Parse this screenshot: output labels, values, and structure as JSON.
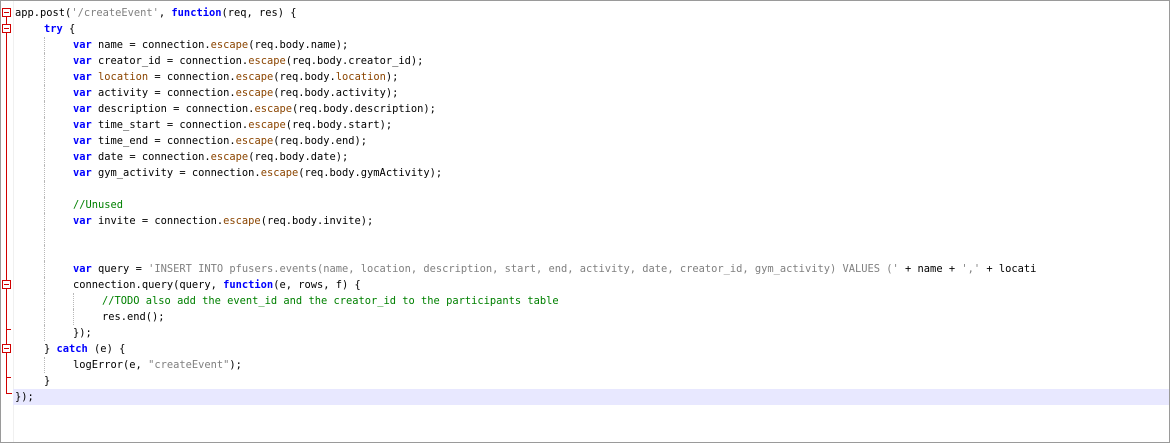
{
  "editor": {
    "lines": [
      {
        "indent": 0,
        "segments": [
          {
            "t": "app.post(",
            "c": "p"
          },
          {
            "t": "'/createEvent'",
            "c": "str"
          },
          {
            "t": ", ",
            "c": "p"
          },
          {
            "t": "function",
            "c": "kw"
          },
          {
            "t": "(req, res) {",
            "c": "p"
          }
        ]
      },
      {
        "indent": 1,
        "segments": [
          {
            "t": "try",
            "c": "kw"
          },
          {
            "t": " {",
            "c": "p"
          }
        ]
      },
      {
        "indent": 2,
        "segments": [
          {
            "t": "var",
            "c": "kw"
          },
          {
            "t": " name = connection.",
            "c": "p"
          },
          {
            "t": "escape",
            "c": "fn"
          },
          {
            "t": "(req.body.name);",
            "c": "p"
          }
        ]
      },
      {
        "indent": 2,
        "segments": [
          {
            "t": "var",
            "c": "kw"
          },
          {
            "t": " creator_id = connection.",
            "c": "p"
          },
          {
            "t": "escape",
            "c": "fn"
          },
          {
            "t": "(req.body.creator_id);",
            "c": "p"
          }
        ]
      },
      {
        "indent": 2,
        "segments": [
          {
            "t": "var",
            "c": "kw"
          },
          {
            "t": " ",
            "c": "p"
          },
          {
            "t": "location",
            "c": "fn"
          },
          {
            "t": " = connection.",
            "c": "p"
          },
          {
            "t": "escape",
            "c": "fn"
          },
          {
            "t": "(req.body.",
            "c": "p"
          },
          {
            "t": "location",
            "c": "fn"
          },
          {
            "t": ");",
            "c": "p"
          }
        ]
      },
      {
        "indent": 2,
        "segments": [
          {
            "t": "var",
            "c": "kw"
          },
          {
            "t": " activity = connection.",
            "c": "p"
          },
          {
            "t": "escape",
            "c": "fn"
          },
          {
            "t": "(req.body.activity);",
            "c": "p"
          }
        ]
      },
      {
        "indent": 2,
        "segments": [
          {
            "t": "var",
            "c": "kw"
          },
          {
            "t": " description = connection.",
            "c": "p"
          },
          {
            "t": "escape",
            "c": "fn"
          },
          {
            "t": "(req.body.description);",
            "c": "p"
          }
        ]
      },
      {
        "indent": 2,
        "segments": [
          {
            "t": "var",
            "c": "kw"
          },
          {
            "t": " time_start = connection.",
            "c": "p"
          },
          {
            "t": "escape",
            "c": "fn"
          },
          {
            "t": "(req.body.start);",
            "c": "p"
          }
        ]
      },
      {
        "indent": 2,
        "segments": [
          {
            "t": "var",
            "c": "kw"
          },
          {
            "t": " time_end = connection.",
            "c": "p"
          },
          {
            "t": "escape",
            "c": "fn"
          },
          {
            "t": "(req.body.end);",
            "c": "p"
          }
        ]
      },
      {
        "indent": 2,
        "segments": [
          {
            "t": "var",
            "c": "kw"
          },
          {
            "t": " date = connection.",
            "c": "p"
          },
          {
            "t": "escape",
            "c": "fn"
          },
          {
            "t": "(req.body.date);",
            "c": "p"
          }
        ]
      },
      {
        "indent": 2,
        "segments": [
          {
            "t": "var",
            "c": "kw"
          },
          {
            "t": " gym_activity = connection.",
            "c": "p"
          },
          {
            "t": "escape",
            "c": "fn"
          },
          {
            "t": "(req.body.gymActivity);",
            "c": "p"
          }
        ]
      },
      {
        "indent": 2,
        "segments": []
      },
      {
        "indent": 2,
        "segments": [
          {
            "t": "//Unused",
            "c": "cm"
          }
        ]
      },
      {
        "indent": 2,
        "segments": [
          {
            "t": "var",
            "c": "kw"
          },
          {
            "t": " invite = connection.",
            "c": "p"
          },
          {
            "t": "escape",
            "c": "fn"
          },
          {
            "t": "(req.body.invite);",
            "c": "p"
          }
        ]
      },
      {
        "indent": 2,
        "segments": []
      },
      {
        "indent": 2,
        "segments": []
      },
      {
        "indent": 2,
        "segments": [
          {
            "t": "var",
            "c": "kw"
          },
          {
            "t": " query = ",
            "c": "p"
          },
          {
            "t": "'INSERT INTO pfusers.events(name, location, description, start, end, activity, date, creator_id, gym_activity) VALUES ('",
            "c": "str"
          },
          {
            "t": " + name + ",
            "c": "p"
          },
          {
            "t": "','",
            "c": "str"
          },
          {
            "t": " + locati",
            "c": "p"
          }
        ]
      },
      {
        "indent": 2,
        "segments": [
          {
            "t": "connection.query(query, ",
            "c": "p"
          },
          {
            "t": "function",
            "c": "kw"
          },
          {
            "t": "(e, rows, f) {",
            "c": "p"
          }
        ]
      },
      {
        "indent": 3,
        "segments": [
          {
            "t": "//TODO also add the event_id and the creator_id to the participants table",
            "c": "cm"
          }
        ]
      },
      {
        "indent": 3,
        "segments": [
          {
            "t": "res.end();",
            "c": "p"
          }
        ]
      },
      {
        "indent": 2,
        "segments": [
          {
            "t": "});",
            "c": "p"
          }
        ]
      },
      {
        "indent": 1,
        "segments": [
          {
            "t": "} ",
            "c": "p"
          },
          {
            "t": "catch",
            "c": "kw"
          },
          {
            "t": " (e) {",
            "c": "p"
          }
        ]
      },
      {
        "indent": 2,
        "segments": [
          {
            "t": "logError(e, ",
            "c": "p"
          },
          {
            "t": "\"createEvent\"",
            "c": "str"
          },
          {
            "t": ");",
            "c": "p"
          }
        ]
      },
      {
        "indent": 1,
        "segments": [
          {
            "t": "}",
            "c": "p"
          }
        ]
      },
      {
        "indent": 0,
        "segments": [
          {
            "t": "});",
            "c": "p"
          }
        ],
        "current": true
      }
    ]
  }
}
